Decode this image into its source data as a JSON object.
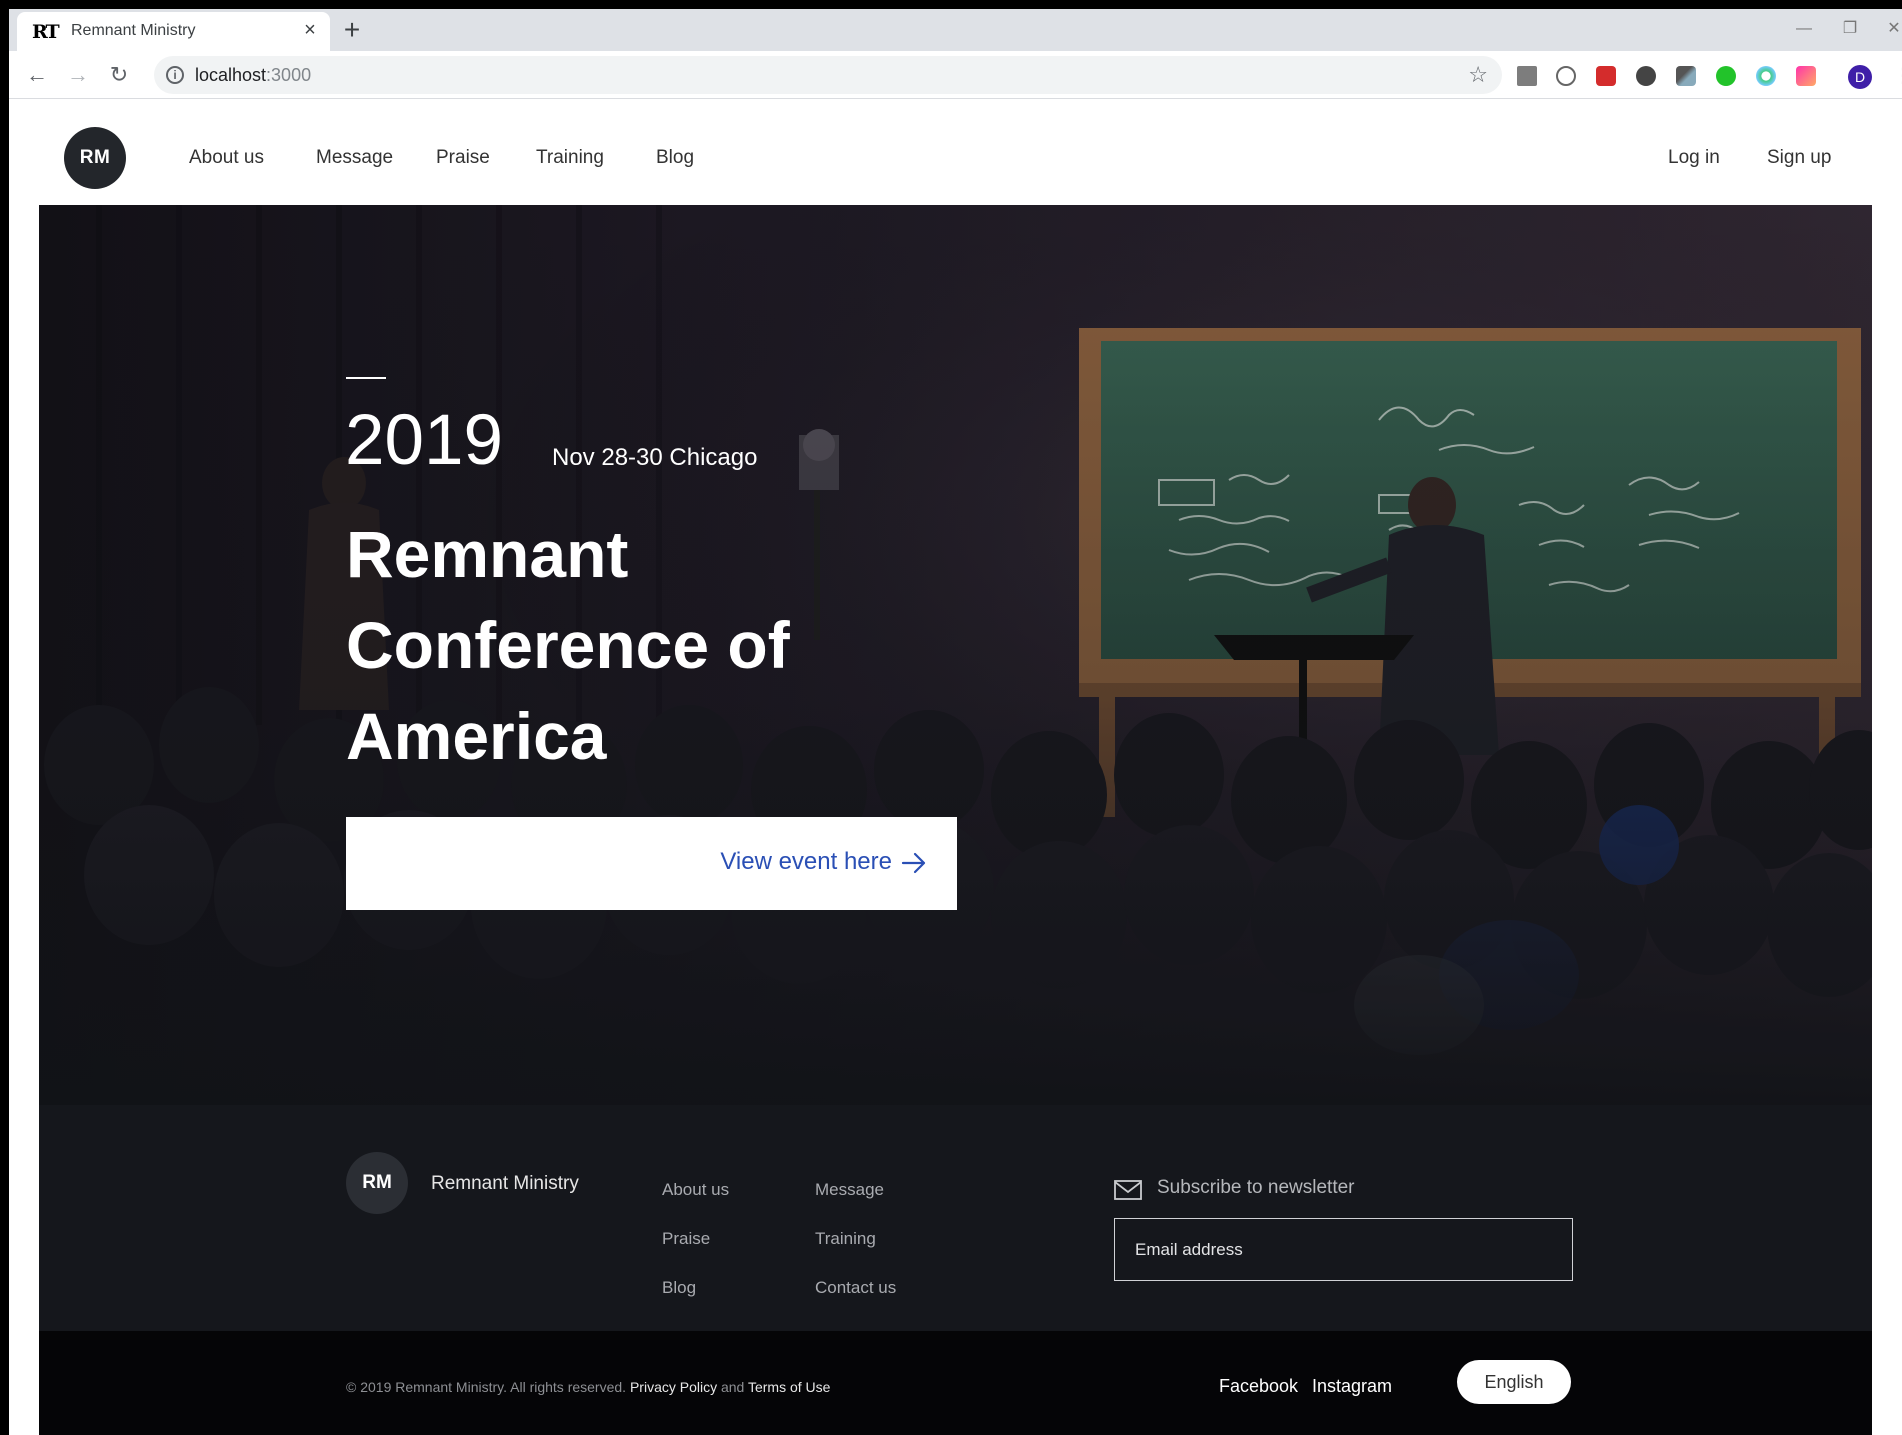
{
  "browser": {
    "tab_title": "Remnant Ministry",
    "tab_favicon": "RT",
    "new_tab": "+",
    "url_host": "localhost",
    "url_port": ":3000",
    "profile_initial": "D"
  },
  "header": {
    "logo": "RM",
    "nav": [
      "About us",
      "Message",
      "Praise",
      "Training",
      "Blog"
    ],
    "login": "Log in",
    "signup": "Sign up"
  },
  "hero": {
    "year": "2019",
    "date_location": "Nov 28-30 Chicago",
    "title": "Remnant Conference of America",
    "cta": "View event here"
  },
  "footer": {
    "logo": "RM",
    "brand": "Remnant Ministry",
    "links": [
      "About us",
      "Message",
      "Praise",
      "Training",
      "Blog",
      "Contact us"
    ],
    "newsletter_title": "Subscribe to newsletter",
    "email_placeholder": "Email address",
    "copyright": "© 2019 Remnant Ministry. All rights reserved.",
    "privacy": "Privacy Policy",
    "and": "and",
    "terms": "Terms of Use",
    "social": [
      "Facebook",
      "Instagram"
    ],
    "language": "English"
  },
  "colors": {
    "accent": "#2a4fb5",
    "dark": "#15171c",
    "logo_bg": "#23262b"
  }
}
